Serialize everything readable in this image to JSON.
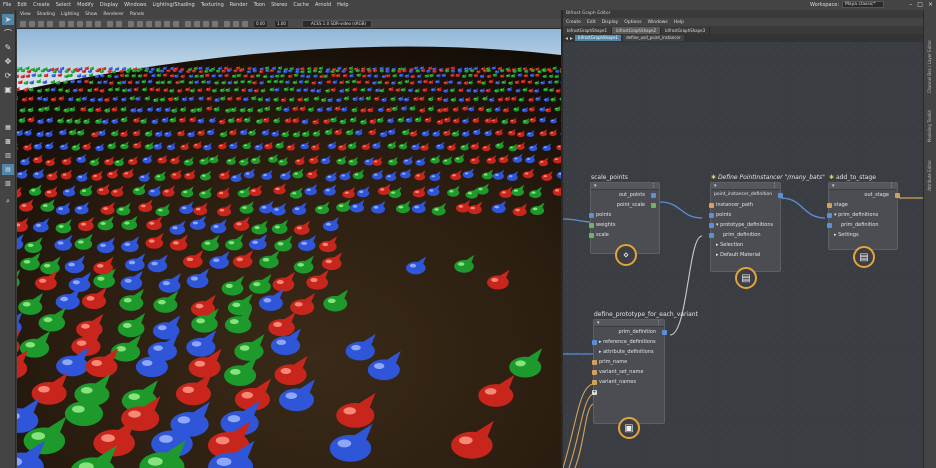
{
  "menubar": {
    "items": [
      "File",
      "Edit",
      "Create",
      "Select",
      "Modify",
      "Display",
      "Windows",
      "Lighting/Shading",
      "Texturing",
      "Render",
      "Toon",
      "Stereo",
      "Cache",
      "Arnold",
      "Help"
    ],
    "workspace_label": "Workspace:",
    "workspace_value": "Maya classic*"
  },
  "viewport": {
    "menu": [
      "View",
      "Shading",
      "Lighting",
      "Show",
      "Renderer",
      "Panels"
    ],
    "field_a": "0.00",
    "field_b": "1.00",
    "colorspace": "ACES 1.0 SDR-video (sRGB)"
  },
  "bifrost": {
    "window_title": "Bifrost Graph Editor",
    "menu": [
      "Create",
      "Edit",
      "Display",
      "Options",
      "Windows",
      "Help"
    ],
    "tabs": [
      "bifrostGraphShape1",
      "bifrostGraphShape2",
      "bifrostGraphShape3"
    ],
    "breadcrumb": [
      "bifrostGraphShape1",
      "define_usd_point_instancer"
    ],
    "nodes": {
      "scale_points": {
        "title": "scale_points",
        "outputs": [
          "out_points",
          "point_scale"
        ],
        "inputs": [
          "points",
          "weights",
          "scale"
        ]
      },
      "point_instancer": {
        "title": "Define PointInstancer \"/many_bats\"",
        "rows": [
          "point_instancer_definition",
          "instancer_path",
          "points",
          "prototype_definitions",
          "prim_definition",
          "Selection",
          "Default Material"
        ]
      },
      "add_to_stage": {
        "title": "add_to_stage",
        "rows": [
          "out_stage",
          "stage",
          "prim_definitions",
          "prim_definition",
          "Settings"
        ]
      },
      "define_prototype": {
        "title": "define_prototype_for_each_variant",
        "rows": [
          "prim_definition",
          "reference_definitions",
          "attribute_definitions",
          "prim_name",
          "variant_set_name",
          "variant_names"
        ]
      }
    }
  },
  "sidebar": {
    "labels": [
      "Channel Box / Layer Editor",
      "Modeling Toolkit",
      "Attribute Editor"
    ]
  },
  "colors": {
    "accent": "#5285a6",
    "badge_ring": "#e0a63a",
    "wire_blue": "#5b8fd8",
    "wire_gold": "#d5a15a",
    "wire_green": "#71b364"
  },
  "icons": {
    "select_tool": "arrow-cursor-icon",
    "lasso_tool": "lasso-icon",
    "paint_tool": "paint-brush-icon",
    "move_tool": "move-icon",
    "rotate_tool": "rotate-icon",
    "scale_tool": "scale-icon",
    "compound": "compound-node-icon"
  }
}
